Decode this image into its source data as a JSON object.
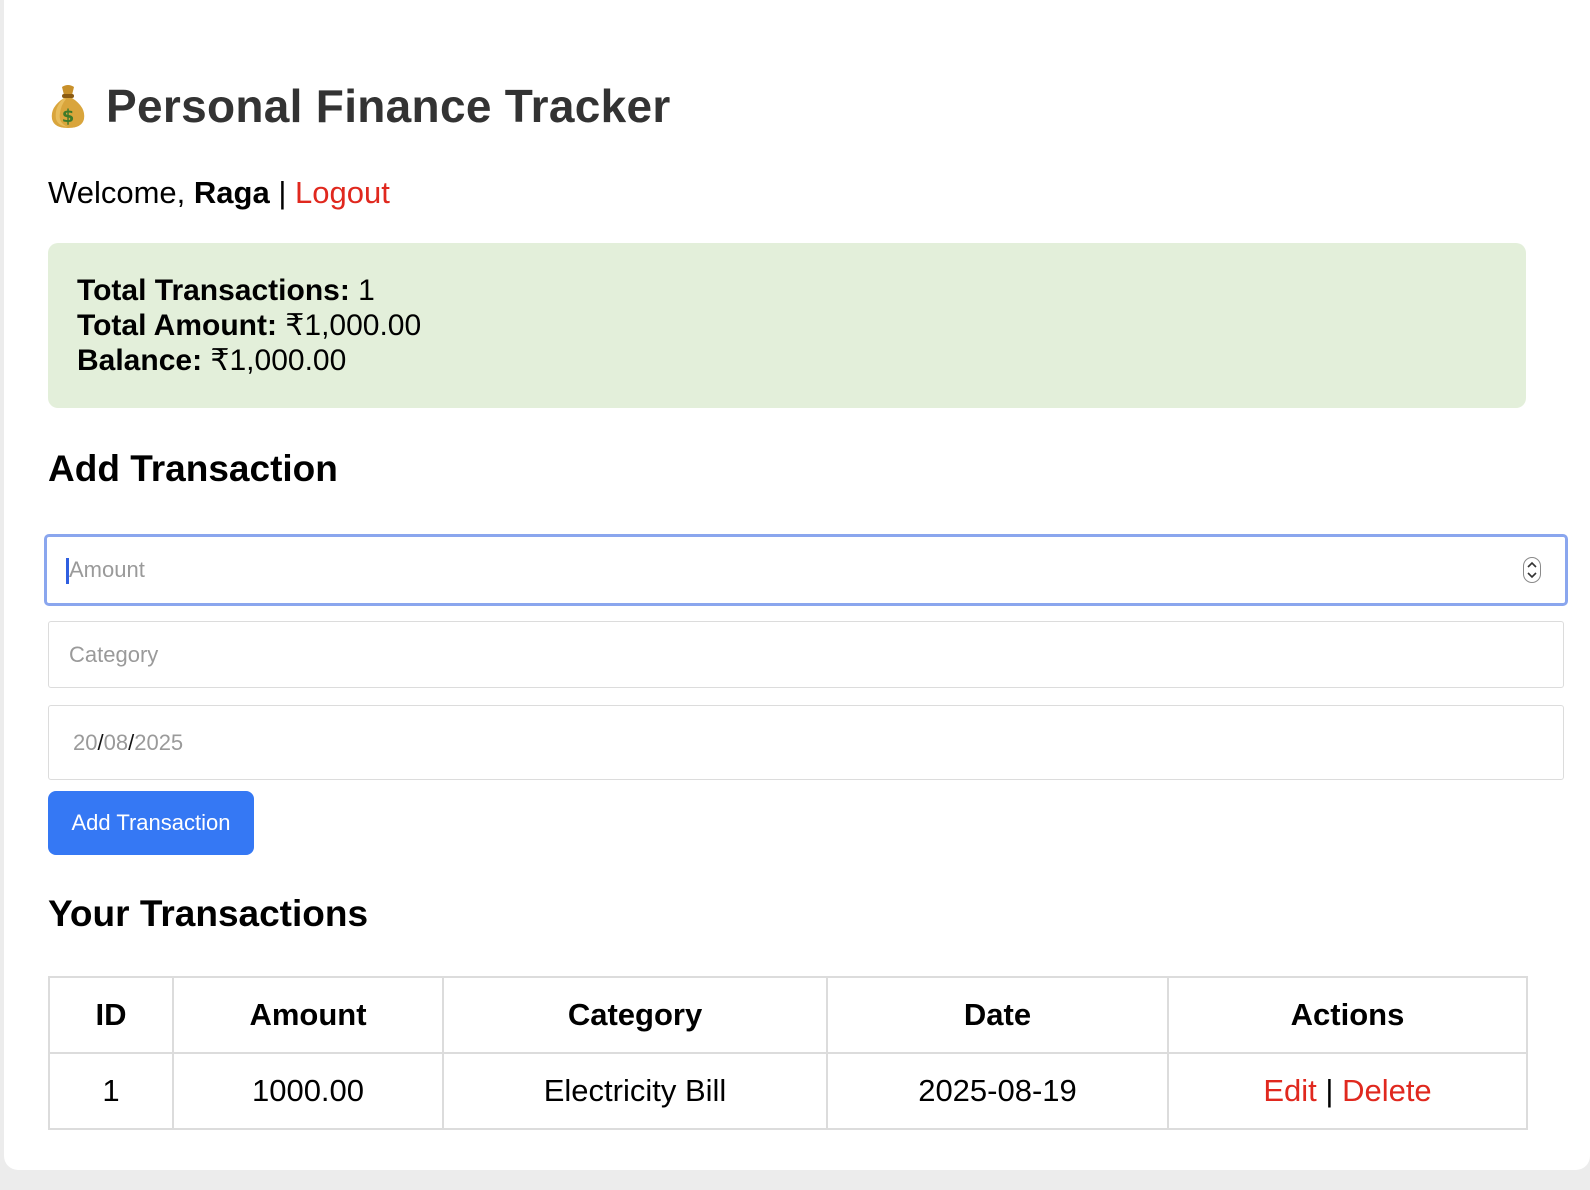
{
  "header": {
    "icon": "money-bag-icon",
    "title": "Personal Finance Tracker"
  },
  "welcome": {
    "prefix": "Welcome,",
    "username": "Raga",
    "separator": "|",
    "logout_label": "Logout"
  },
  "summary": {
    "total_transactions_label": "Total Transactions:",
    "total_transactions_value": "1",
    "total_amount_label": "Total Amount:",
    "total_amount_value": "₹1,000.00",
    "balance_label": "Balance:",
    "balance_value": "₹1,000.00"
  },
  "add_form": {
    "heading": "Add Transaction",
    "amount_placeholder": "Amount",
    "category_placeholder": "Category",
    "date_day": "20",
    "date_month": "08",
    "date_year": "2025",
    "date_separator": "/",
    "submit_label": "Add Transaction"
  },
  "transactions": {
    "heading": "Your Transactions",
    "columns": [
      "ID",
      "Amount",
      "Category",
      "Date",
      "Actions"
    ],
    "rows": [
      {
        "id": "1",
        "amount": "1000.00",
        "category": "Electricity Bill",
        "date": "2025-08-19",
        "edit_label": "Edit",
        "action_separator": "|",
        "delete_label": "Delete"
      }
    ]
  },
  "colors": {
    "link": "#e0281e",
    "summary_bg": "#e3efda",
    "button": "#3578f4",
    "focus_ring": "#8aa6ee"
  }
}
